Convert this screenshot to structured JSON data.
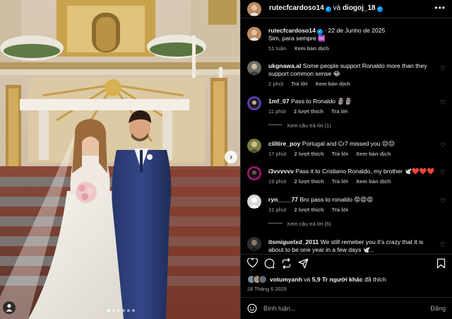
{
  "post_header": {
    "author": "rutecfcardoso14",
    "connector": "và",
    "coauthor": "diogoj_18",
    "more_icon": "more-horizontal-icon"
  },
  "caption": {
    "author": "rutecfcardoso14",
    "date": "22 de Junho de 2025",
    "text": "Sim, para sempre ♾️",
    "age": "51 tuần",
    "translate": "Xem bản dịch"
  },
  "comments": [
    {
      "user": "ukgnawa.al",
      "text": "Some people support Ronaldo more than they support common sense 😂",
      "time": "2 phút",
      "likes": "",
      "reply": "Trả lời",
      "translate": "Xem bản dịch",
      "avatar_color": "#6b6f63"
    },
    {
      "user": "1mf_07",
      "text": "Pass to Ronaldo 🗿🗿",
      "time": "11 phút",
      "likes": "2 lượt thích",
      "reply": "Trả lời",
      "translate": "",
      "avatar_color": "#5a3fb0",
      "replies_label": "Xem câu trả lời (1)"
    },
    {
      "user": "ciiltire_poy",
      "text": "Portugal and Cr7 missed you 😔😔",
      "time": "17 phút",
      "likes": "2 lượt thích",
      "reply": "Trả lời",
      "translate": "Xem bản dịch",
      "avatar_color": "#7a7f45"
    },
    {
      "user": "i3vvvvvv",
      "text": "Pass it to Cristiano Ronaldo, my brother 🕊️❤️❤️❤️",
      "time": "19 phút",
      "likes": "2 lượt thích",
      "reply": "Trả lời",
      "translate": "Xem bản dịch",
      "avatar_color": "#b0127a"
    },
    {
      "user": "ryn____77",
      "text": "Bro pass to ronaldo 😡😡😡",
      "time": "31 phút",
      "likes": "2 lượt thích",
      "reply": "Trả lời",
      "translate": "",
      "avatar_color": "#d9d9d9",
      "replies_label": "Xem câu trả lời (6)"
    },
    {
      "user": "itsmiguelxd_2011",
      "text": "We still remeber you it's crazy that it is about to be one year in a few days 🕊️..",
      "time": "",
      "likes": "",
      "reply": "",
      "translate": "",
      "avatar_color": "#2e2e2e"
    }
  ],
  "actions": {
    "like_icon": "heart-icon",
    "comment_icon": "comment-icon",
    "repost_icon": "repost-icon",
    "share_icon": "send-icon",
    "save_icon": "bookmark-icon"
  },
  "likes": {
    "user": "votumyanh",
    "connector": "và",
    "others": "5,9 Tr người khác",
    "suffix": "đã thích"
  },
  "post_date": "28 Tháng 6 2025",
  "composer": {
    "placeholder": "Bình luận...",
    "post_label": "Đăng",
    "emoji_icon": "emoji-icon"
  },
  "carousel": {
    "next_icon": "chevron-right-icon",
    "dot_count": 6,
    "active_index": 0
  }
}
